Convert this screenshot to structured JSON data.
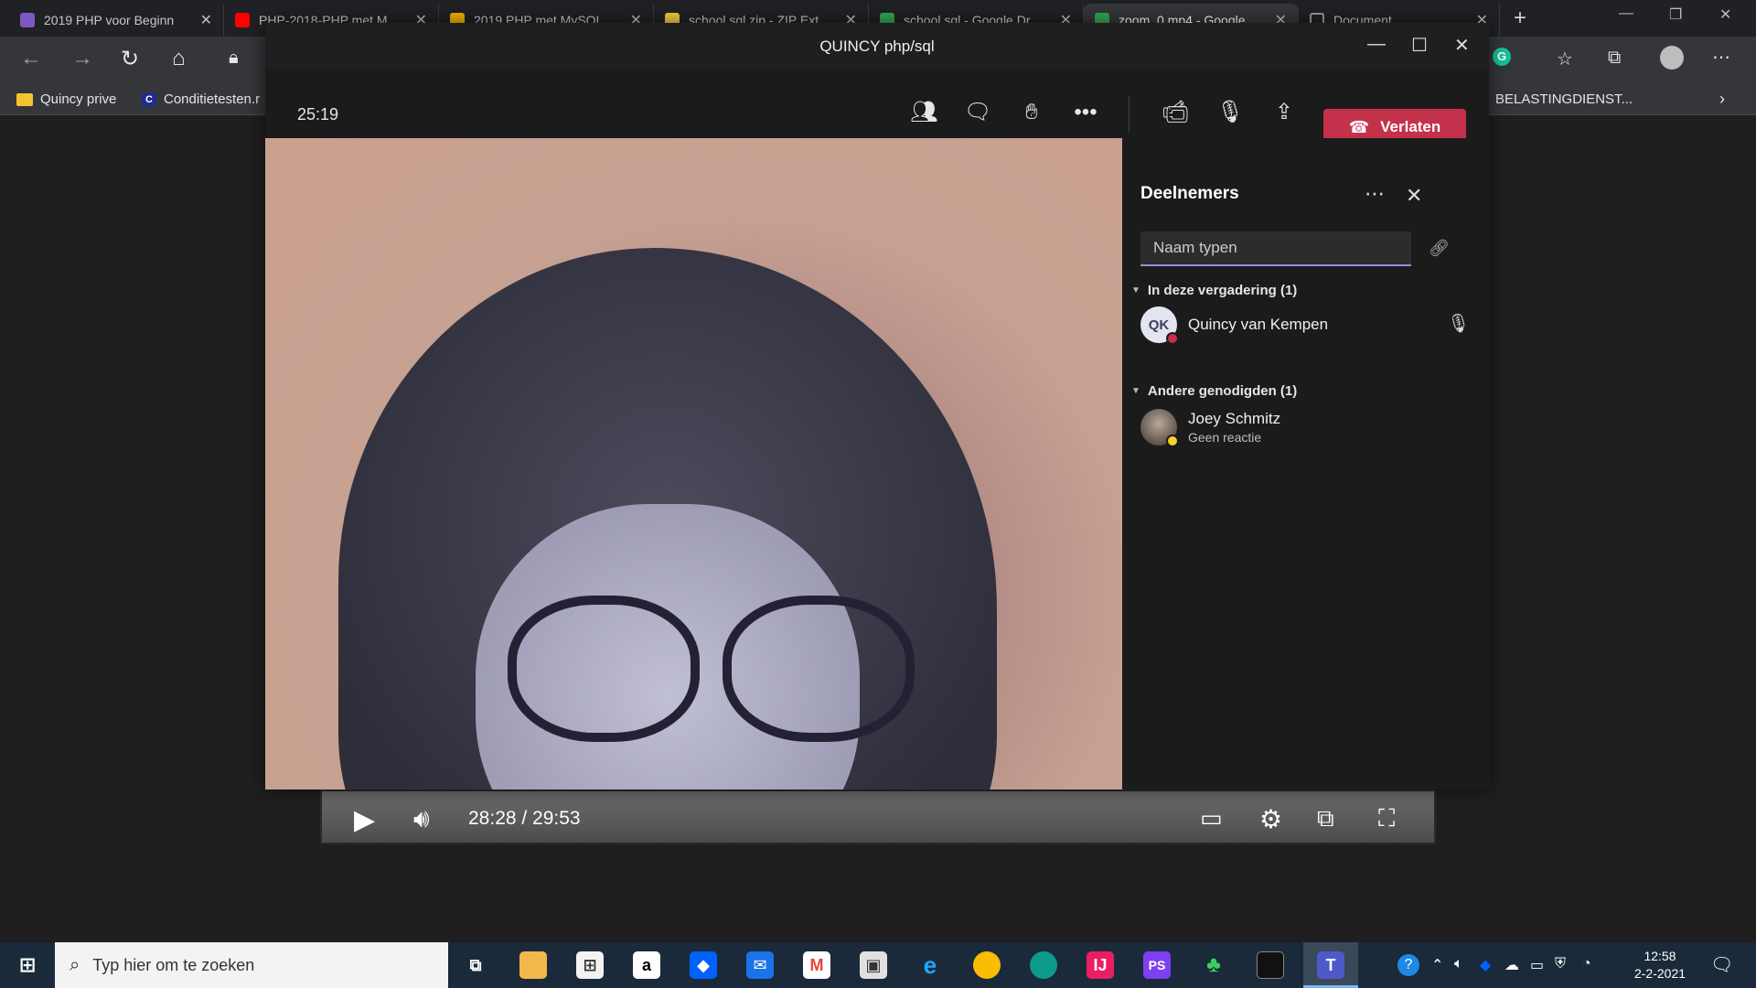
{
  "browser": {
    "tabs": [
      {
        "title": "2019 PHP voor Beginn",
        "fav_color": "#7e57c2"
      },
      {
        "title": "PHP-2018-PHP met M",
        "fav_color": "#ff0000"
      },
      {
        "title": "2019 PHP met MySQL",
        "fav_color": "#f4b400"
      },
      {
        "title": "school.sql.zip - ZIP Ext",
        "fav_color": "#f4d03f"
      },
      {
        "title": "school.sql - Google Dr",
        "fav_color": "#34a853"
      },
      {
        "title": "zoom_0.mp4 - Google",
        "fav_color": "#34a853"
      },
      {
        "title": "Document",
        "fav_color": "#9aa0a6"
      }
    ],
    "bookmarks": [
      {
        "label": "Quincy prive"
      },
      {
        "label": "Conditietesten.r"
      },
      {
        "label": "BELASTINGDIENST..."
      }
    ]
  },
  "teams": {
    "window_title": "QUINCY php/sql",
    "timer": "25:19",
    "leave_label": "Verlaten",
    "panel": {
      "title": "Deelnemers",
      "search_placeholder": "Naam typen",
      "group_in_meeting": "In deze vergadering (1)",
      "group_invited": "Andere genodigden (1)",
      "participants": [
        {
          "initials": "QK",
          "name": "Quincy van Kempen",
          "status_color": "#c4314b"
        },
        {
          "name": "Joey Schmitz",
          "subtitle": "Geen reactie",
          "status_color": "#f8d22a"
        }
      ]
    }
  },
  "player": {
    "time": "28:28 / 29:53"
  },
  "taskbar": {
    "search_placeholder": "Typ hier om te zoeken",
    "time": "12:58",
    "date": "2-2-2021"
  }
}
